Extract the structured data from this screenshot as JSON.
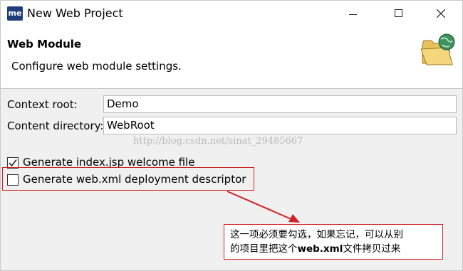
{
  "window": {
    "app_icon_text": "me",
    "title": "New Web Project"
  },
  "header": {
    "title": "Web Module",
    "description": "Configure web module settings."
  },
  "form": {
    "context_root_label": "Context root:",
    "context_root_value": "Demo",
    "content_directory_label": "Content directory:",
    "content_directory_value": "WebRoot"
  },
  "watermark": "http://blog.csdn.net/sinat_29485667",
  "options": [
    {
      "label": "Generate index.jsp welcome file",
      "checked": true
    },
    {
      "label": "Generate web.xml deployment descriptor",
      "checked": false
    }
  ],
  "annotation": {
    "line1": "这一项必须要勾选，如果忘记，可以从别",
    "line2_pre": "的项目里把这个",
    "line2_bold": "web.xml",
    "line2_post": "文件拷贝过来",
    "color": "#d32020"
  }
}
